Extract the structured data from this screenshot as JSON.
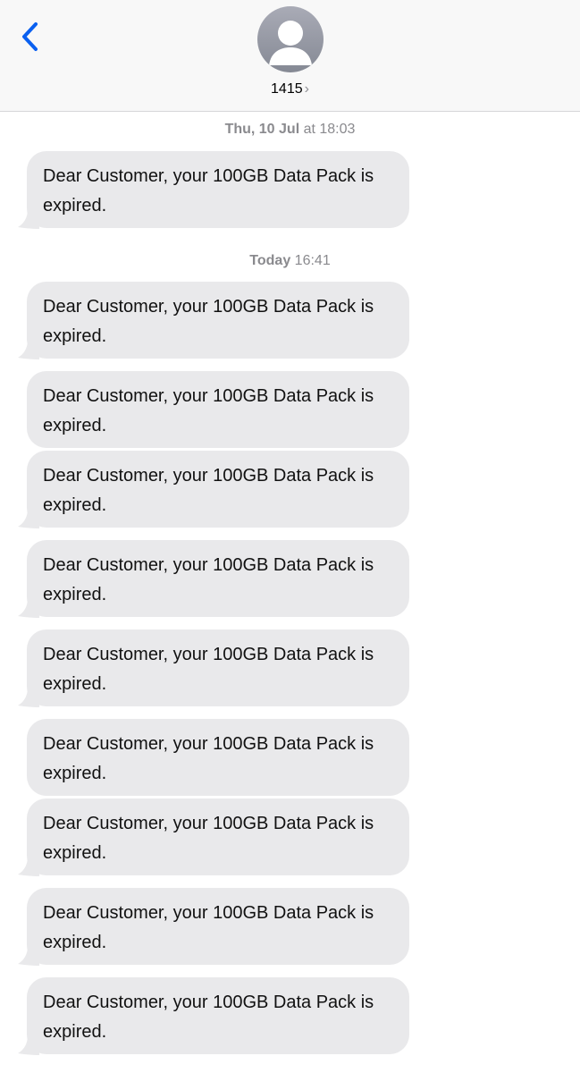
{
  "header": {
    "contact_name": "1415",
    "chevron": "›"
  },
  "icons": {
    "back": "chevron-left-icon",
    "avatar": "person-silhouette-icon"
  },
  "colors": {
    "accent": "#0a60f0",
    "bubble": "#e9e9eb",
    "timestamp": "#8a8a8e"
  },
  "thread": {
    "timestamps": [
      {
        "day": "Thu, 10 Jul",
        "time": "at 18:03"
      },
      {
        "day": "Today",
        "time": "16:41"
      }
    ],
    "messages": [
      "Dear Customer, your 100GB Data Pack is expired.",
      "Dear Customer, your 100GB Data Pack is expired.",
      "Dear Customer, your 100GB Data Pack is expired.",
      "Dear Customer, your 100GB Data Pack is expired.",
      "Dear Customer, your 100GB Data Pack is expired.",
      "Dear Customer, your 100GB Data Pack is expired.",
      "Dear Customer, your 100GB Data Pack is expired.",
      "Dear Customer, your 100GB Data Pack is expired.",
      "Dear Customer, your 100GB Data Pack is expired.",
      "Dear Customer, your 100GB Data Pack is expired."
    ]
  }
}
